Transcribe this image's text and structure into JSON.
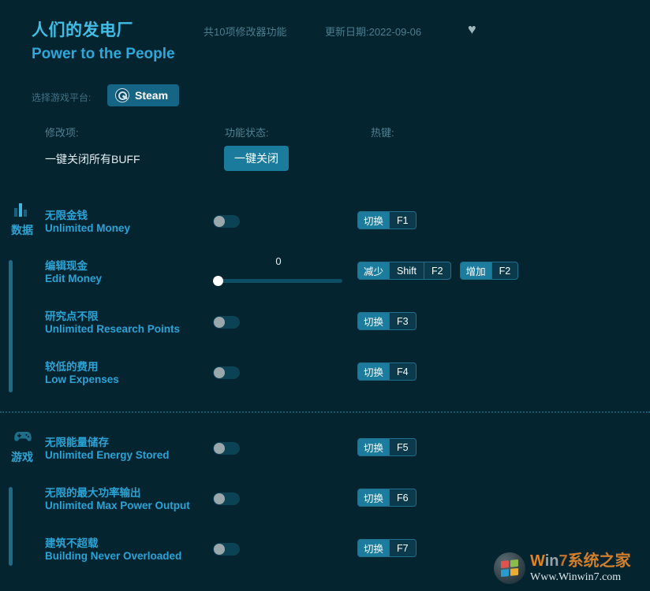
{
  "header": {
    "title_cn": "人们的发电厂",
    "title_en": "Power to the People",
    "feature_count": "共10项修改器功能",
    "update_date": "更新日期:2022-09-06",
    "favorite_icon": "♥"
  },
  "platform": {
    "label": "选择游戏平台:",
    "selected": "Steam",
    "icon": "steam-icon"
  },
  "columns": {
    "option": "修改项:",
    "status": "功能状态:",
    "hotkey": "热键:"
  },
  "onekey": {
    "name": "一键关闭所有BUFF",
    "button": "一键关闭"
  },
  "colors": {
    "background": "#04242f",
    "accent": "#2aa3d6",
    "teal_button": "#1b7b9c",
    "rail": "#1d6b86",
    "toggle_off_track": "#0c4256",
    "toggle_knob": "#9aa8ac"
  },
  "sections": [
    {
      "name": "数据",
      "icon": "bar-chart-icon",
      "rows": [
        {
          "cn": "无限金钱",
          "en": "Unlimited Money",
          "control": "toggle",
          "state": "off",
          "hotkeys": [
            {
              "action": "切换",
              "keys": [
                "F1"
              ]
            }
          ]
        },
        {
          "cn": "编辑现金",
          "en": "Edit Money",
          "control": "slider",
          "value": "0",
          "hotkeys": [
            {
              "action": "减少",
              "keys": [
                "Shift",
                "F2"
              ]
            },
            {
              "action": "增加",
              "keys": [
                "F2"
              ]
            }
          ]
        },
        {
          "cn": "研究点不限",
          "en": "Unlimited Research Points",
          "control": "toggle",
          "state": "off",
          "hotkeys": [
            {
              "action": "切换",
              "keys": [
                "F3"
              ]
            }
          ]
        },
        {
          "cn": "较低的费用",
          "en": "Low Expenses",
          "control": "toggle",
          "state": "off",
          "hotkeys": [
            {
              "action": "切换",
              "keys": [
                "F4"
              ]
            }
          ]
        }
      ]
    },
    {
      "name": "游戏",
      "icon": "gamepad-icon",
      "rows": [
        {
          "cn": "无限能量储存",
          "en": "Unlimited Energy Stored",
          "control": "toggle",
          "state": "off",
          "hotkeys": [
            {
              "action": "切换",
              "keys": [
                "F5"
              ]
            }
          ]
        },
        {
          "cn": "无限的最大功率输出",
          "en": "Unlimited Max Power Output",
          "control": "toggle",
          "state": "off",
          "hotkeys": [
            {
              "action": "切换",
              "keys": [
                "F6"
              ]
            }
          ]
        },
        {
          "cn": "建筑不超载",
          "en": "Building Never Overloaded",
          "control": "toggle",
          "state": "off",
          "hotkeys": [
            {
              "action": "切换",
              "keys": [
                "F7"
              ]
            }
          ]
        }
      ]
    }
  ],
  "watermark": {
    "brand_w": "W",
    "brand_in": "in",
    "brand_7": "7",
    "brand_cn": "系统之家",
    "url": "Www.Winwin7.com"
  }
}
